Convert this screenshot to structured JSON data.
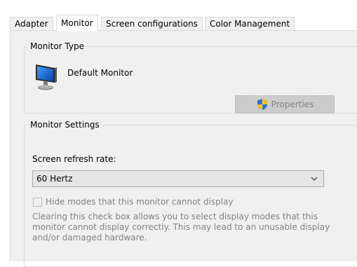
{
  "tabs": [
    {
      "label": "Adapter",
      "active": false
    },
    {
      "label": "Monitor",
      "active": true
    },
    {
      "label": "Screen configurations",
      "active": false
    },
    {
      "label": "Color Management",
      "active": false
    }
  ],
  "monitor_type": {
    "legend": "Monitor Type",
    "monitor_name": "Default Monitor",
    "icon": "monitor-icon",
    "properties_button": {
      "label": "Properties",
      "icon": "uac-shield-icon",
      "disabled": true
    }
  },
  "monitor_settings": {
    "legend": "Monitor Settings",
    "refresh_label": "Screen refresh rate:",
    "refresh_value": "60 Hertz",
    "hide_modes_checkbox": {
      "label": "Hide modes that this monitor cannot display",
      "checked": false,
      "disabled": true
    },
    "description": "Clearing this check box allows you to select display modes that this monitor cannot display correctly. This may lead to an unusable display and/or damaged hardware."
  },
  "colors": {
    "page_bg": "#f0f0f0",
    "disabled_text": "#838383",
    "button_bg": "#cccccc",
    "select_bg": "#e5e5e5"
  }
}
